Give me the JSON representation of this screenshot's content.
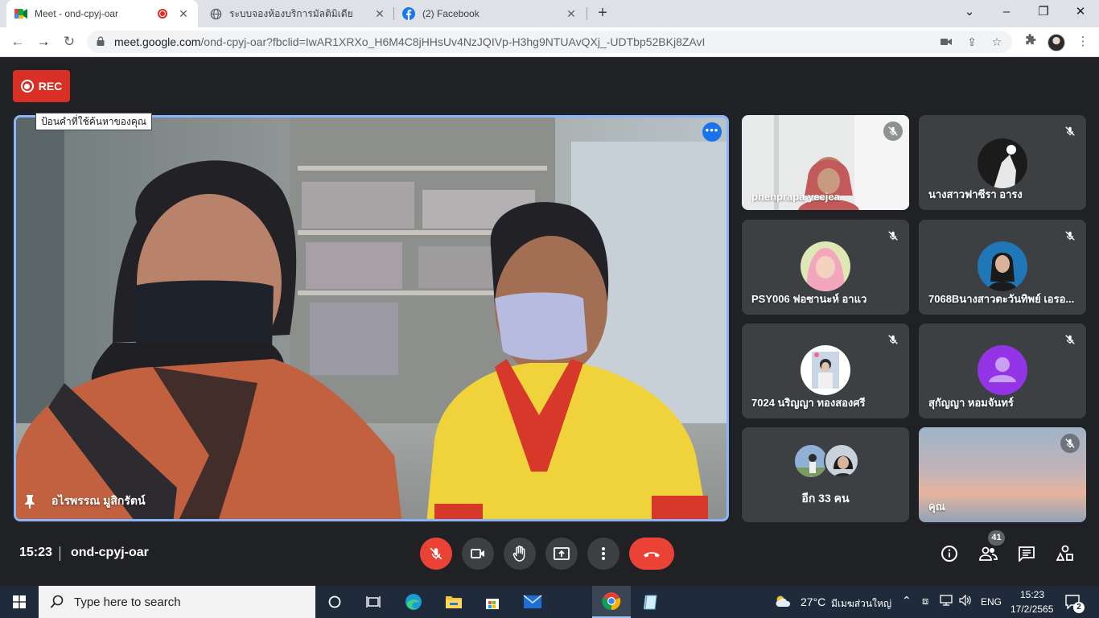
{
  "browser": {
    "tabs": [
      {
        "title": "Meet - ond-cpyj-oar",
        "recording": true,
        "icon": "google-meet-icon"
      },
      {
        "title": "ระบบจองห้องบริการมัลติมิเดีย",
        "icon": "globe-icon"
      },
      {
        "title": "(2) Facebook",
        "icon": "facebook-icon"
      }
    ],
    "url_host": "meet.google.com",
    "url_rest": "/ond-cpyj-oar?fbclid=IwAR1XRXo_H6M4C8jHHsUv4NzJQIVp-H3hg9NTUAvQXj_-UDTbp52BKj8ZAvI"
  },
  "meet": {
    "rec_label": "REC",
    "tooltip": "ป้อนคำที่ใช้ค้นหาของคุณ",
    "main_speaker": "อไรพรรณ มูสิกรัตน์",
    "participants": [
      {
        "name": "phenprapa yeejea",
        "type": "video"
      },
      {
        "name": "นางสาวฟาซีรา อารง",
        "type": "avatar"
      },
      {
        "name": "PSY006 ฟอซานะห์ อาแว",
        "type": "avatar"
      },
      {
        "name": "7068Bนางสาวตะวันทิพย์ เอรอ...",
        "type": "avatar"
      },
      {
        "name": "7024 นริญญา ทองสองศรี",
        "type": "avatar"
      },
      {
        "name": "สุกัญญา หอมจันทร์",
        "type": "avatar"
      },
      {
        "more_label": "อีก 33 คน",
        "type": "group"
      },
      {
        "name": "คุณ",
        "type": "self"
      }
    ],
    "clock": "15:23",
    "meeting_code": "ond-cpyj-oar",
    "participant_count": "41",
    "colors": {
      "accent": "#8ab4f8",
      "danger": "#ea4335",
      "surface": "#3c4043",
      "background": "#202124"
    }
  },
  "taskbar": {
    "search_placeholder": "Type here to search",
    "weather_temp": "27°C",
    "weather_text": "มีเมฆส่วนใหญ่",
    "language": "ENG",
    "time": "15:23",
    "date": "17/2/2565",
    "notification_count": "2"
  }
}
